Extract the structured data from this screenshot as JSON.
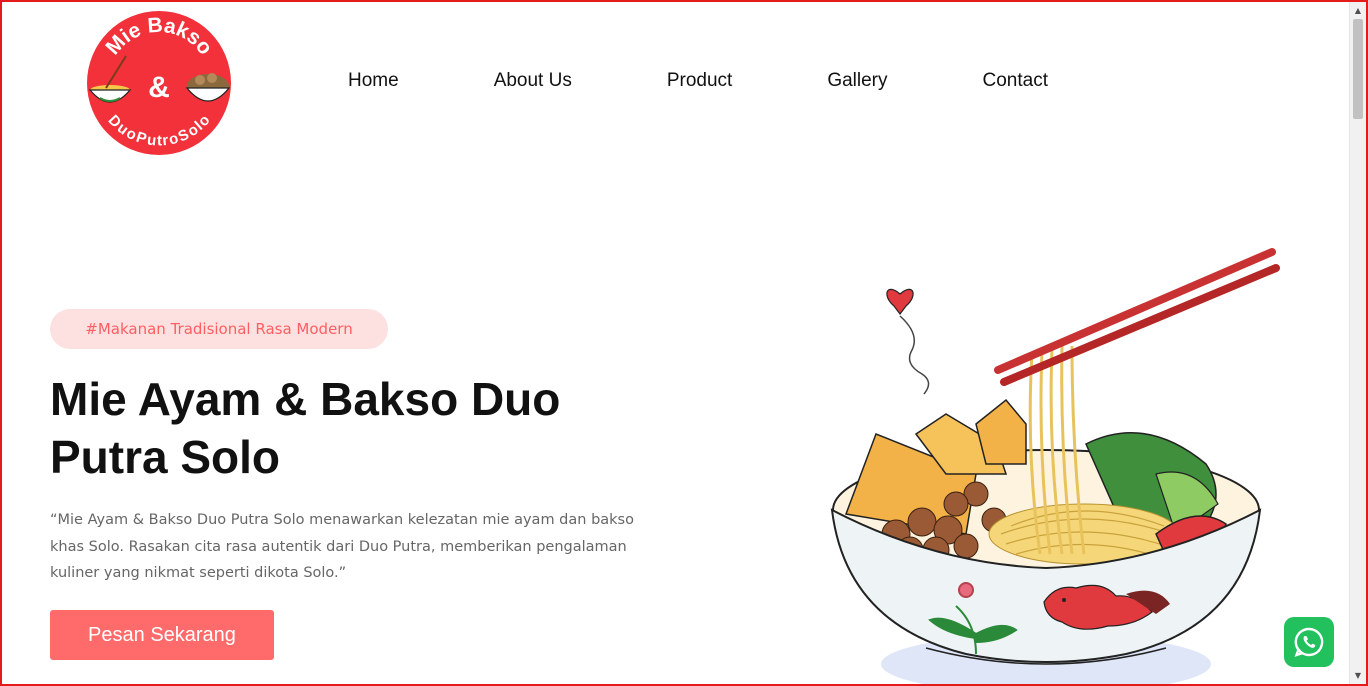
{
  "logo": {
    "top_text": "Mie Bakso",
    "middle": "&",
    "bottom_text": "DuoPutroSolo",
    "color": "#f2313b"
  },
  "nav": {
    "items": [
      {
        "label": "Home"
      },
      {
        "label": "About Us"
      },
      {
        "label": "Product"
      },
      {
        "label": "Gallery"
      },
      {
        "label": "Contact"
      }
    ]
  },
  "hero": {
    "tag": "#Makanan Tradisional Rasa Modern",
    "title": "Mie Ayam & Bakso Duo Putra Solo",
    "description": "“Mie Ayam & Bakso Duo Putra Solo menawarkan kelezatan mie ayam dan bakso khas Solo. Rasakan cita rasa autentik dari Duo Putra, memberikan pengalaman kuliner yang nikmat seperti dikota Solo.”",
    "cta_label": "Pesan Sekarang",
    "accent_color": "#ff6b6b"
  },
  "whatsapp": {
    "icon": "whatsapp-icon",
    "color": "#22c15e"
  }
}
